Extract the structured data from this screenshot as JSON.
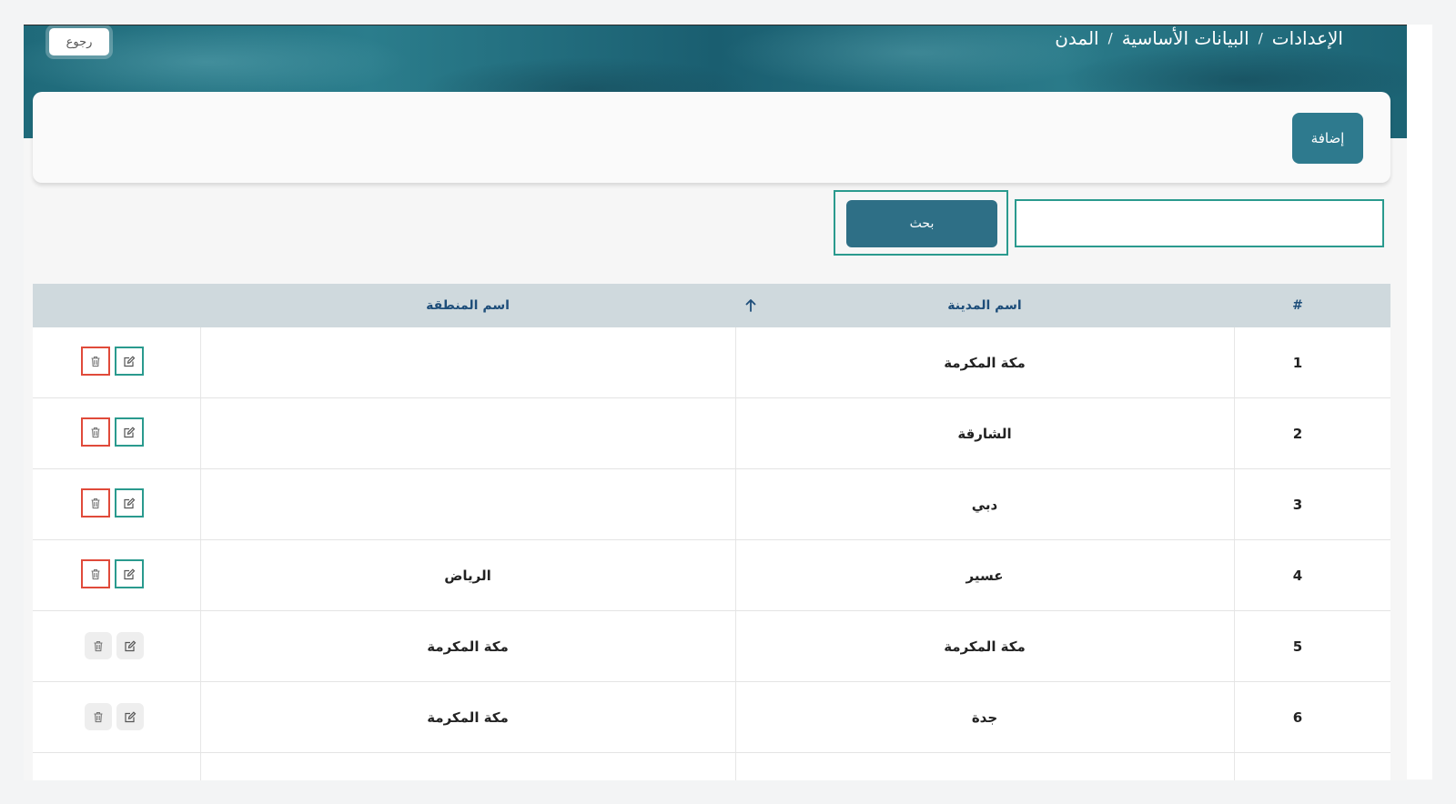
{
  "header": {
    "back_label": "رجوع",
    "breadcrumb": [
      "الإعدادات",
      "البيانات الأساسية",
      "المدن"
    ],
    "separator": "/"
  },
  "toolbar": {
    "add_label": "إضافة",
    "search_button_label": "بحث",
    "search_value": ""
  },
  "table": {
    "headers": {
      "index": "#",
      "city_name": "اسم المدينة",
      "region_name": "اسم المنطقة"
    },
    "sort_icon": "arrow-up-icon",
    "rows": [
      {
        "index": "1",
        "city": "مكة المكرمة",
        "region": ""
      },
      {
        "index": "2",
        "city": "الشارقة",
        "region": ""
      },
      {
        "index": "3",
        "city": "دبي",
        "region": ""
      },
      {
        "index": "4",
        "city": "عسير",
        "region": "الرياض"
      },
      {
        "index": "5",
        "city": "مكة المكرمة",
        "region": "مكة المكرمة"
      },
      {
        "index": "6",
        "city": "جدة",
        "region": "مكة المكرمة"
      }
    ]
  },
  "colors": {
    "primary": "#2e7a8e",
    "accent_border": "#2a9a8e",
    "delete_border": "#e04a3a",
    "header_bg": "#cfd9dd",
    "header_text": "#1e4e7a"
  }
}
